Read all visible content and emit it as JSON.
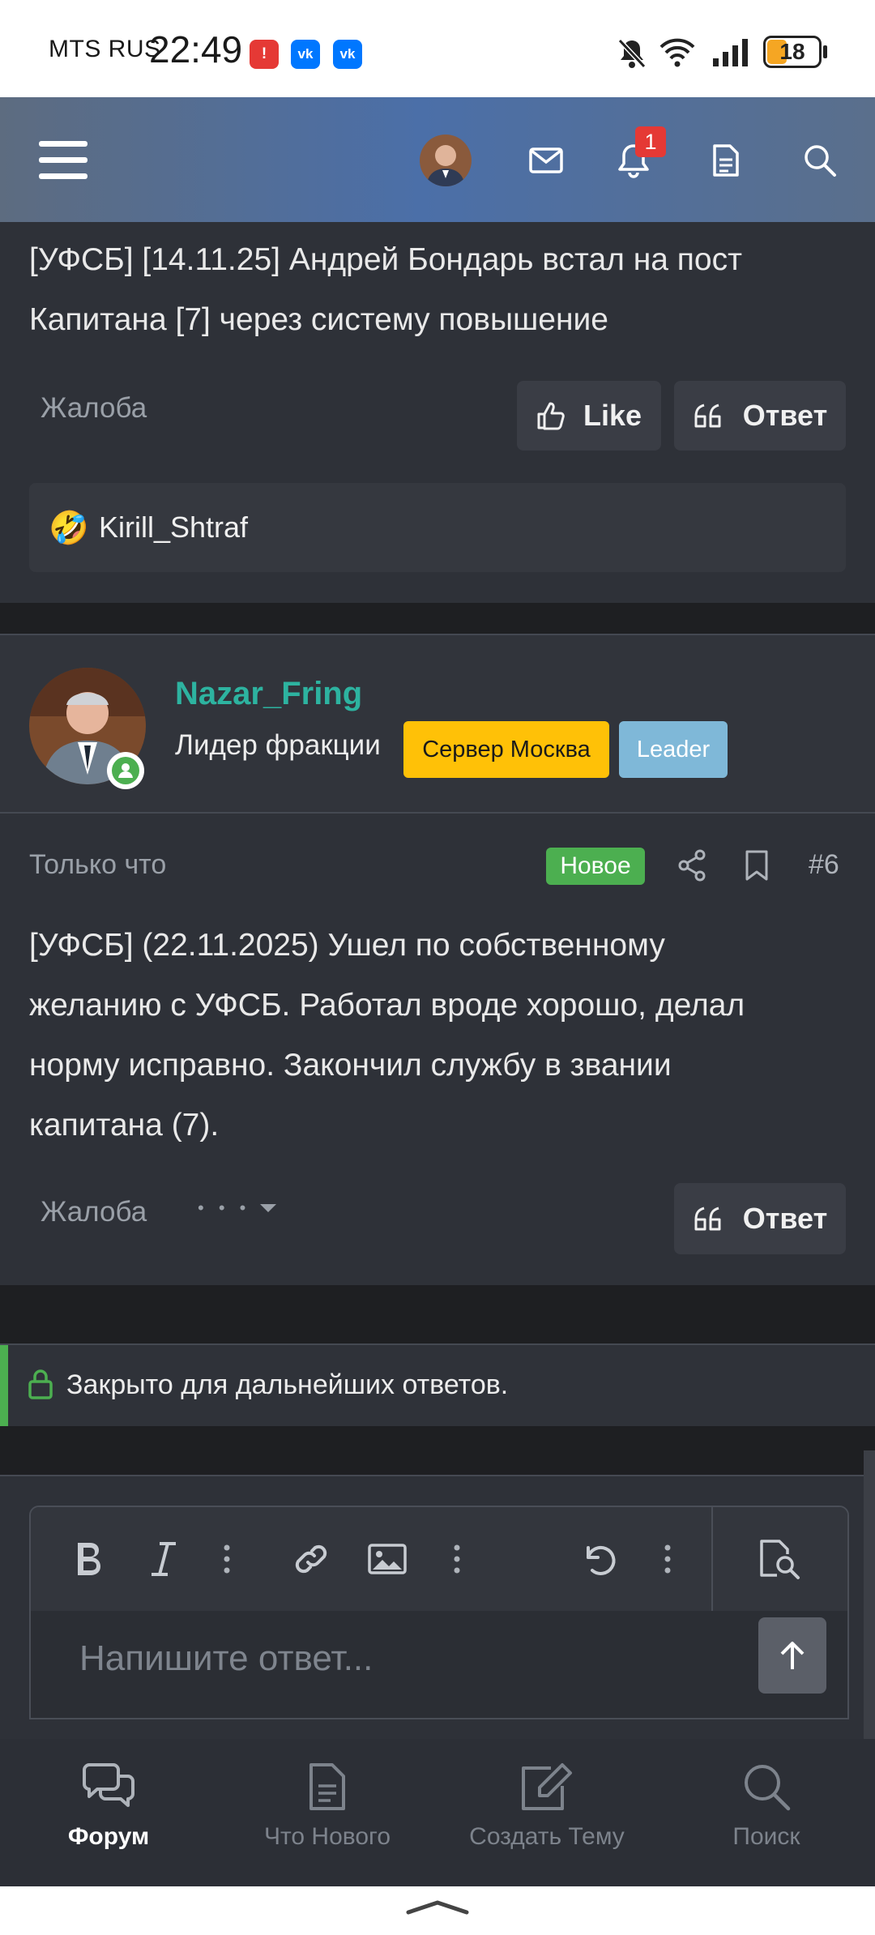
{
  "status_bar": {
    "carrier": "MTS RUS",
    "time": "22:49",
    "battery": "18",
    "notif_icons": [
      "alert-app-icon",
      "vk-icon",
      "vk-icon"
    ],
    "colors": {
      "alert": "#e53935",
      "vk": "#0077ff"
    }
  },
  "header": {
    "notification_count": "1",
    "icons": [
      "menu-icon",
      "avatar",
      "mail-icon",
      "bell-icon",
      "document-icon",
      "search-icon"
    ]
  },
  "prev_post": {
    "text_lines": [
      "[УФСБ] [14.11.25] Андрей Бондарь встал на пост",
      "Капитана [7] через систему повышение"
    ],
    "report_label": "Жалоба",
    "like_label": "Like",
    "reply_label": "Ответ",
    "reaction": {
      "emoji": "🤣",
      "user": "Kirill_Shtraf"
    }
  },
  "post": {
    "author": "Nazar_Fring",
    "role": "Лидер фракции",
    "badge_server": "Сервер Москва",
    "badge_leader": "Leader",
    "time": "Только что",
    "new_badge": "Новое",
    "number": "#6",
    "text_lines": [
      "[УФСБ] (22.11.2025) Ушел по собственному",
      "желанию с УФСБ. Работал вроде хорошо, делал",
      "норму исправно. Закончил службу в звании",
      "капитана (7)."
    ],
    "report_label": "Жалоба",
    "more_dots": "• • •",
    "reply_label": "Ответ"
  },
  "closed_notice": "Закрыто для дальнейших ответов.",
  "editor": {
    "placeholder": "Напишите ответ...",
    "tools": [
      "bold-icon",
      "italic-icon",
      "more-icon",
      "link-icon",
      "image-icon",
      "more-icon",
      "undo-icon",
      "more-icon",
      "preview-icon"
    ]
  },
  "bottom_nav": [
    {
      "label": "Форум",
      "icon": "chat-bubbles-icon",
      "active": true
    },
    {
      "label": "Что Нового",
      "icon": "document-icon",
      "active": false
    },
    {
      "label": "Создать Тему",
      "icon": "edit-icon",
      "active": false
    },
    {
      "label": "Поиск",
      "icon": "search-icon",
      "active": false
    }
  ],
  "colors": {
    "author_name": "#2db3a0",
    "new_badge": "#4caf50",
    "server_badge": "#ffc107",
    "leader_badge": "#7fb8d8",
    "closed_accent": "#4caf50",
    "notification_badge": "#e53935"
  }
}
